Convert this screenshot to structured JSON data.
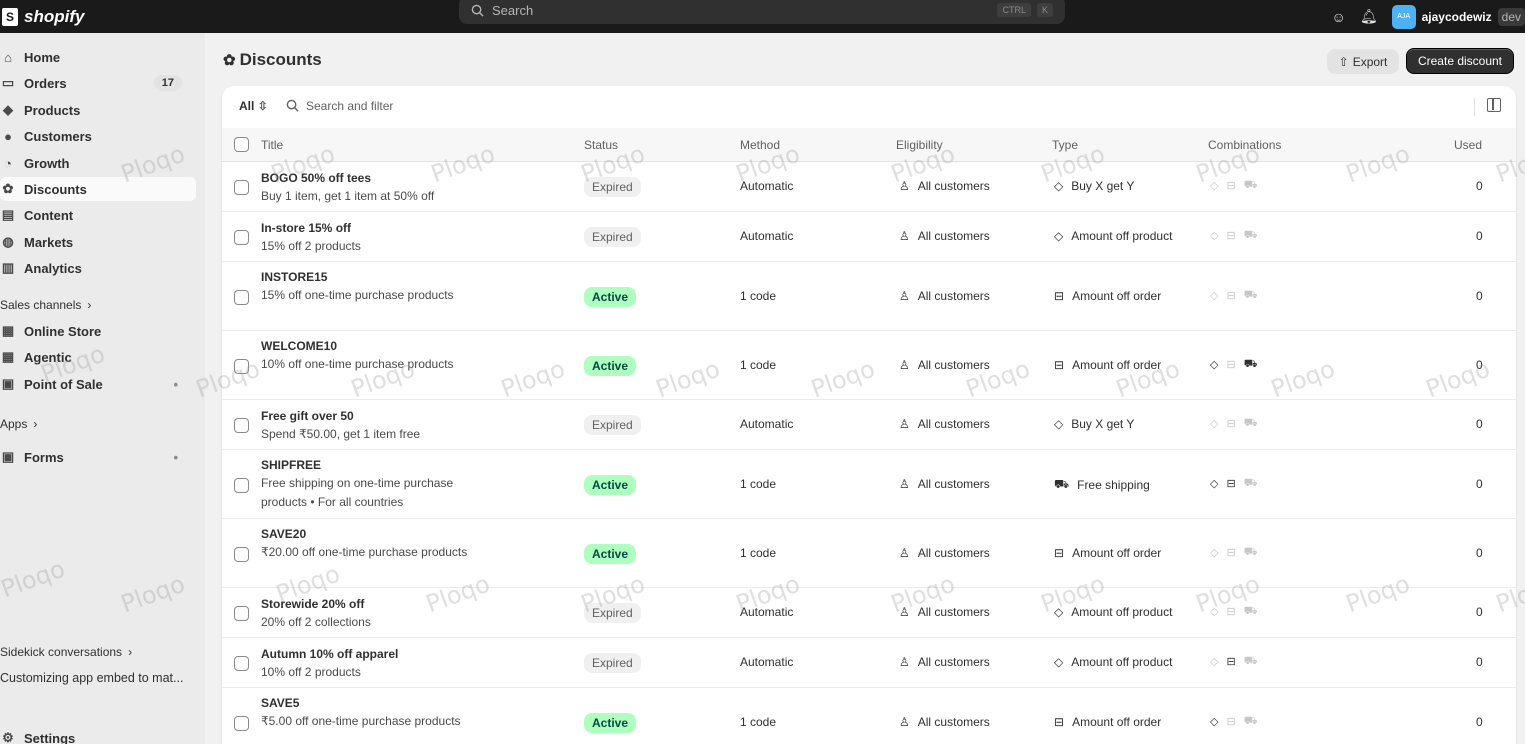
{
  "topbar": {
    "logo_text": "shopify",
    "search_placeholder": "Search",
    "shortcut_keys": [
      "CTRL",
      "K"
    ],
    "avatar_initials": "AJA",
    "store_name": "ajaycodewiz",
    "store_tag": "dev"
  },
  "sidebar": {
    "items": [
      {
        "label": "Home",
        "icon": "home-icon"
      },
      {
        "label": "Orders",
        "icon": "orders-icon",
        "count": "17"
      },
      {
        "label": "Products",
        "icon": "tag-icon"
      },
      {
        "label": "Customers",
        "icon": "person-icon"
      },
      {
        "label": "Growth",
        "icon": "growth-icon"
      },
      {
        "label": "Discounts",
        "icon": "discount-icon",
        "active": true
      },
      {
        "label": "Content",
        "icon": "content-icon"
      },
      {
        "label": "Markets",
        "icon": "globe-icon"
      },
      {
        "label": "Analytics",
        "icon": "bar-chart-icon"
      }
    ],
    "sales_channels_label": "Sales channels",
    "channels": [
      {
        "label": "Online Store",
        "icon": "store-icon"
      },
      {
        "label": "Agentic",
        "icon": "store-icon"
      },
      {
        "label": "Point of Sale",
        "icon": "pos-icon"
      }
    ],
    "apps_label": "Apps",
    "apps": [
      {
        "label": "Forms",
        "icon": "forms-icon"
      }
    ],
    "sidekick_label": "Sidekick conversations",
    "sidekick_item": "Customizing app embed to mat...",
    "settings_label": "Settings"
  },
  "page": {
    "title": "Discounts",
    "export_label": "Export",
    "create_label": "Create discount"
  },
  "filter": {
    "all_label": "All",
    "search_placeholder": "Search and filter"
  },
  "table": {
    "headers": [
      "Title",
      "Status",
      "Method",
      "Eligibility",
      "Type",
      "Combinations",
      "Used"
    ],
    "rows": [
      {
        "title": "BOGO 50% off tees",
        "desc": "Buy 1 item, get 1 item at 50% off",
        "status": "Expired",
        "method": "Automatic",
        "eligibility": "All customers",
        "type": "Buy X get Y",
        "type_icon": "tag-icon",
        "combos": [
          false,
          false,
          false
        ],
        "used": "0"
      },
      {
        "title": "In-store 15% off",
        "desc": "15% off 2 products",
        "status": "Expired",
        "method": "Automatic",
        "eligibility": "All customers",
        "type": "Amount off product",
        "type_icon": "tag-icon",
        "combos": [
          false,
          false,
          false
        ],
        "used": "0"
      },
      {
        "title": "INSTORE15",
        "desc": "15% off one-time purchase products",
        "status": "Active",
        "method": "1 code",
        "eligibility": "All customers",
        "type": "Amount off order",
        "type_icon": "cart-icon",
        "combos": [
          false,
          false,
          false
        ],
        "used": "0"
      },
      {
        "title": "WELCOME10",
        "desc": "10% off one-time purchase products",
        "status": "Active",
        "method": "1 code",
        "eligibility": "All customers",
        "type": "Amount off order",
        "type_icon": "cart-icon",
        "combos": [
          true,
          false,
          true
        ],
        "used": "0"
      },
      {
        "title": "Free gift over 50",
        "desc": "Spend ₹50.00, get 1 item free",
        "status": "Expired",
        "method": "Automatic",
        "eligibility": "All customers",
        "type": "Buy X get Y",
        "type_icon": "tag-icon",
        "combos": [
          false,
          false,
          false
        ],
        "used": "0"
      },
      {
        "title": "SHIPFREE",
        "desc": "Free shipping on one-time purchase products • For all countries",
        "status": "Active",
        "method": "1 code",
        "eligibility": "All customers",
        "type": "Free shipping",
        "type_icon": "truck-icon",
        "combos": [
          true,
          true,
          false
        ],
        "used": "0"
      },
      {
        "title": "SAVE20",
        "desc": "₹20.00 off one-time purchase products",
        "status": "Active",
        "method": "1 code",
        "eligibility": "All customers",
        "type": "Amount off order",
        "type_icon": "cart-icon",
        "combos": [
          false,
          false,
          false
        ],
        "used": "0"
      },
      {
        "title": "Storewide 20% off",
        "desc": "20% off 2 collections",
        "status": "Expired",
        "method": "Automatic",
        "eligibility": "All customers",
        "type": "Amount off product",
        "type_icon": "tag-icon",
        "combos": [
          false,
          false,
          false
        ],
        "used": "0"
      },
      {
        "title": "Autumn 10% off apparel",
        "desc": "10% off 2 products",
        "status": "Expired",
        "method": "Automatic",
        "eligibility": "All customers",
        "type": "Amount off product",
        "type_icon": "tag-icon",
        "combos": [
          false,
          true,
          false
        ],
        "used": "0"
      },
      {
        "title": "SAVE5",
        "desc": "₹5.00 off one-time purchase products",
        "status": "Active",
        "method": "1 code",
        "eligibility": "All customers",
        "type": "Amount off order",
        "type_icon": "cart-icon",
        "combos": [
          true,
          false,
          false
        ],
        "used": "0"
      }
    ]
  },
  "watermark": "Ploqo"
}
